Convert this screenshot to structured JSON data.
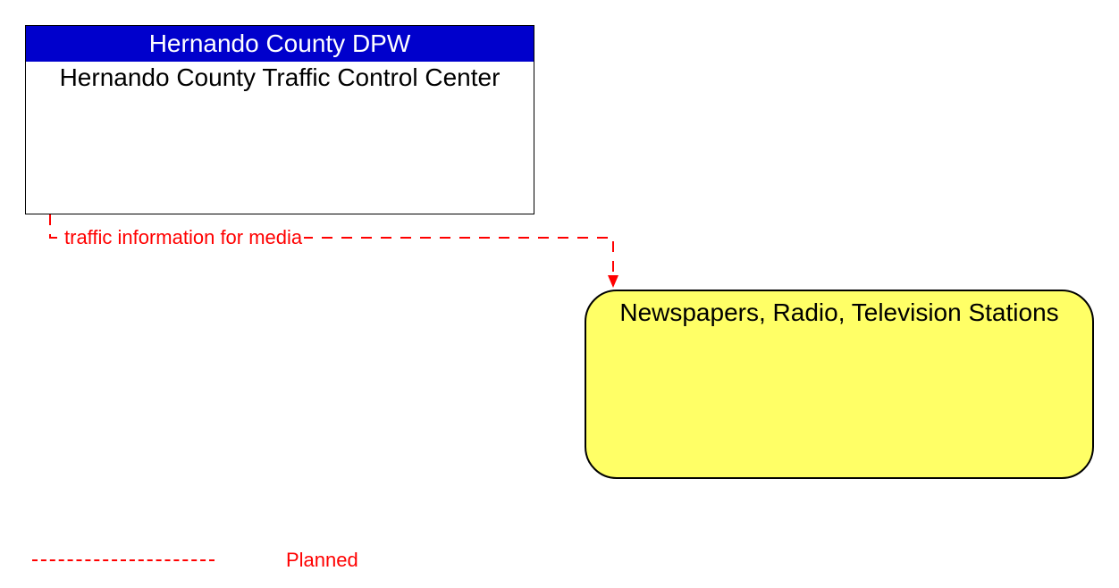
{
  "source_box": {
    "header": "Hernando County DPW",
    "title": "Hernando County Traffic Control Center"
  },
  "target_box": {
    "title": "Newspapers, Radio, Television Stations"
  },
  "flow": {
    "label": "traffic information for media"
  },
  "legend": {
    "planned": "Planned"
  },
  "colors": {
    "header_bg": "#0000cc",
    "target_bg": "#ffff66",
    "flow_color": "#ff0000"
  }
}
